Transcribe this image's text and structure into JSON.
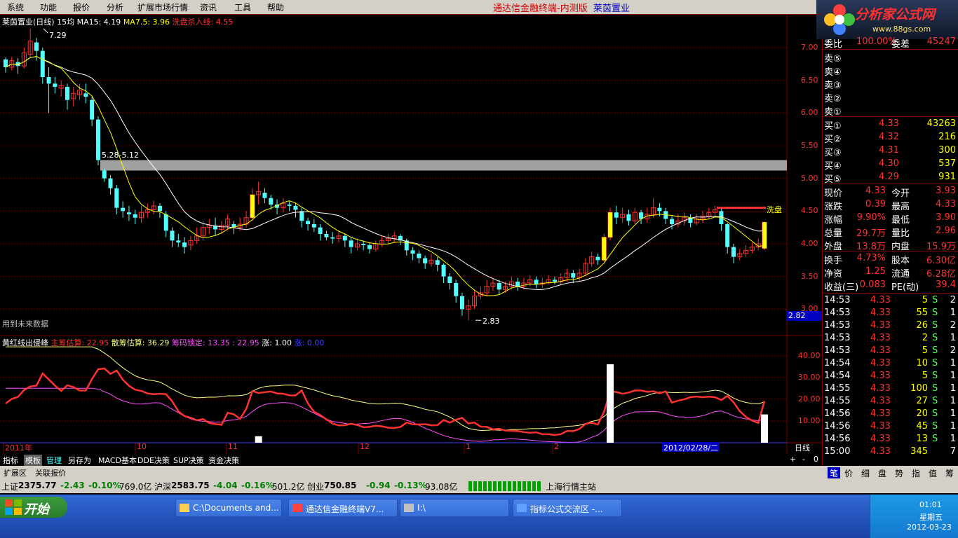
{
  "menu": [
    "系统",
    "功能",
    "报价",
    "分析",
    "扩展市场行情",
    "资讯",
    "工具",
    "帮助"
  ],
  "window_title": {
    "app": "通达信金融终端-内测版",
    "stock": "莱茵置业"
  },
  "logo": {
    "name": "分析家公式网",
    "url": "www.88gs.com"
  },
  "chart_info": {
    "stock_name": "莱茵置业(日线)",
    "ma_type": "15均",
    "ma15": "MA15: 4.19",
    "ma7": "MA7.5: 3.96",
    "wash": "洗盘杀入线: 4.55",
    "high_label": "7.29",
    "low_label": "2.83",
    "gap_label": "5.28-5.12",
    "wash_right_label": "洗盘",
    "future_label": "用到未来数据",
    "current_price_tag": "2.82"
  },
  "indicator": {
    "name": "黄红线出侵峰",
    "main": "主筹估算: 22.95",
    "loose": "散筹估算: 36.29",
    "lock": "筹码锁定: 13.35 : 22.95",
    "up": "涨: 1.00",
    "tail": "涨: 0.00"
  },
  "price_axis": [
    "7.00",
    "6.50",
    "6.00",
    "5.50",
    "5.00",
    "4.50",
    "4.00",
    "3.50",
    "3.00"
  ],
  "indicator_axis": [
    "40.00",
    "30.00",
    "20.00",
    "10.00"
  ],
  "time_axis": [
    {
      "label": "2011年",
      "x": 5
    },
    {
      "label": "10",
      "x": 193
    },
    {
      "label": "11",
      "x": 323
    },
    {
      "label": "12",
      "x": 511
    },
    {
      "label": "1",
      "x": 662
    },
    {
      "label": "2",
      "x": 788
    }
  ],
  "cursor_date": "2012/02/28/二",
  "period_label": "日线",
  "order_book": {
    "ratio_label": "委比",
    "ratio_value": "100.00%",
    "diff_label": "委差",
    "diff_value": "45247",
    "sells": [
      "卖⑤",
      "卖④",
      "卖③",
      "卖②",
      "卖①"
    ],
    "buys": [
      {
        "label": "买①",
        "price": "4.33",
        "vol": "43263"
      },
      {
        "label": "买②",
        "price": "4.32",
        "vol": "216"
      },
      {
        "label": "买③",
        "price": "4.31",
        "vol": "300"
      },
      {
        "label": "买④",
        "price": "4.30",
        "vol": "537"
      },
      {
        "label": "买⑤",
        "price": "4.29",
        "vol": "931"
      }
    ]
  },
  "quote": [
    {
      "k1": "现价",
      "v1": "4.33",
      "k2": "今开",
      "v2": "3.93"
    },
    {
      "k1": "涨跌",
      "v1": "0.39",
      "k2": "最高",
      "v2": "4.33"
    },
    {
      "k1": "涨幅",
      "v1": "9.90%",
      "k2": "最低",
      "v2": "3.90"
    },
    {
      "k1": "总量",
      "v1": "29.7万",
      "k2": "量比",
      "v2": "2.96"
    },
    {
      "k1": "外盘",
      "v1": "13.8万",
      "k2": "内盘",
      "v2": "15.9万"
    }
  ],
  "stats": [
    {
      "k1": "换手",
      "v1": "4.73%",
      "k2": "股本",
      "v2": "6.30亿"
    },
    {
      "k1": "净资",
      "v1": "1.25",
      "k2": "流通",
      "v2": "6.28亿"
    },
    {
      "k1": "收益(三)",
      "v1": "0.083",
      "k2": "PE(动)",
      "v2": "39.4"
    }
  ],
  "ticks": [
    {
      "time": "14:53",
      "price": "4.33",
      "vol": "5",
      "side": "S",
      "n": "2"
    },
    {
      "time": "14:53",
      "price": "4.33",
      "vol": "55",
      "side": "S",
      "n": "1"
    },
    {
      "time": "14:53",
      "price": "4.33",
      "vol": "26",
      "side": "S",
      "n": "2"
    },
    {
      "time": "14:53",
      "price": "4.33",
      "vol": "2",
      "side": "S",
      "n": "1"
    },
    {
      "time": "14:53",
      "price": "4.33",
      "vol": "5",
      "side": "S",
      "n": "2"
    },
    {
      "time": "14:54",
      "price": "4.33",
      "vol": "10",
      "side": "S",
      "n": "1"
    },
    {
      "time": "14:54",
      "price": "4.33",
      "vol": "5",
      "side": "S",
      "n": "1"
    },
    {
      "time": "14:55",
      "price": "4.33",
      "vol": "100",
      "side": "S",
      "n": "1"
    },
    {
      "time": "14:55",
      "price": "4.33",
      "vol": "27",
      "side": "S",
      "n": "1"
    },
    {
      "time": "14:56",
      "price": "4.33",
      "vol": "20",
      "side": "S",
      "n": "1"
    },
    {
      "time": "14:56",
      "price": "4.33",
      "vol": "45",
      "side": "S",
      "n": "1"
    },
    {
      "time": "14:56",
      "price": "4.33",
      "vol": "13",
      "side": "S",
      "n": "1"
    },
    {
      "time": "15:00",
      "price": "4.33",
      "vol": "345",
      "side": "",
      "n": "7"
    }
  ],
  "side_tabs": [
    "笔",
    "价",
    "细",
    "盘",
    "势",
    "指",
    "值",
    "筹"
  ],
  "bottom_tabs": [
    "指标",
    "模板",
    "管理",
    "另存为",
    "MACD基本",
    "DDE决策",
    "SUP决策",
    "资金决策"
  ],
  "bottom_controls": [
    "+",
    "-",
    "0"
  ],
  "ext_tabs": [
    "扩展区",
    "关联报价"
  ],
  "indexes": [
    {
      "name": "上证",
      "val": "2375.77",
      "chg": "-2.43",
      "pct": "-0.10%",
      "amt": "769.0亿"
    },
    {
      "name": "沪深",
      "val": "2583.75",
      "chg": "-4.04",
      "pct": "-0.16%",
      "amt": "501.2亿"
    },
    {
      "name": "创业",
      "val": "750.85",
      "chg": "-0.94",
      "pct": "-0.13%",
      "amt": "93.08亿"
    }
  ],
  "server": "上海行情主站",
  "taskbar": {
    "start": "开始",
    "tasks": [
      "C:\\Documents and...",
      "通达信金融终端V7...",
      "I:\\",
      "指标公式交流区 -..."
    ],
    "time": "01:01",
    "weekday": "星期五",
    "date": "2012-03-23"
  },
  "colors": {
    "up": "#ff3232",
    "down": "#54ffff",
    "yellow": "#ffff00",
    "grid": "#800000",
    "purple": "#ff50ff"
  },
  "chart_data": {
    "type": "candlestick",
    "y_range": [
      2.8,
      7.3
    ],
    "indicator_range": [
      0,
      45
    ],
    "candles": [
      [
        6.82,
        6.7,
        6.85,
        6.62
      ],
      [
        6.7,
        6.8,
        6.86,
        6.65
      ],
      [
        6.78,
        6.72,
        6.84,
        6.6
      ],
      [
        6.72,
        6.92,
        7.0,
        6.68
      ],
      [
        6.9,
        7.1,
        7.29,
        6.85
      ],
      [
        7.08,
        6.95,
        7.15,
        6.8
      ],
      [
        6.95,
        6.55,
        7.0,
        6.45
      ],
      [
        6.55,
        6.45,
        6.7,
        6.0
      ],
      [
        6.45,
        6.4,
        6.55,
        6.3
      ],
      [
        6.38,
        6.42,
        6.5,
        6.25
      ],
      [
        6.4,
        6.2,
        6.45,
        6.05
      ],
      [
        6.22,
        6.3,
        6.4,
        6.1
      ],
      [
        6.28,
        6.35,
        6.45,
        6.2
      ],
      [
        6.3,
        6.25,
        6.45,
        6.15
      ],
      [
        6.2,
        5.9,
        6.25,
        5.8
      ],
      [
        5.9,
        5.28,
        5.95,
        5.2
      ],
      [
        5.12,
        5.0,
        5.15,
        4.95
      ],
      [
        5.0,
        4.85,
        5.05,
        4.75
      ],
      [
        4.85,
        4.55,
        4.9,
        4.45
      ],
      [
        4.55,
        4.5,
        4.65,
        4.4
      ],
      [
        4.48,
        4.45,
        4.58,
        4.35
      ],
      [
        4.45,
        4.4,
        4.52,
        4.3
      ],
      [
        4.4,
        4.48,
        4.58,
        4.32
      ],
      [
        4.48,
        4.52,
        4.62,
        4.4
      ],
      [
        4.52,
        4.58,
        4.66,
        4.45
      ],
      [
        4.58,
        4.5,
        4.62,
        4.4
      ],
      [
        4.45,
        4.2,
        4.5,
        4.1
      ],
      [
        4.2,
        4.05,
        4.25,
        3.95
      ],
      [
        4.05,
        4.02,
        4.15,
        3.95
      ],
      [
        4.02,
        3.95,
        4.1,
        3.85
      ],
      [
        3.98,
        4.05,
        4.12,
        3.9
      ],
      [
        4.05,
        4.12,
        4.25,
        4.0
      ],
      [
        4.12,
        4.25,
        4.35,
        4.05
      ],
      [
        4.25,
        4.28,
        4.38,
        4.15
      ],
      [
        4.28,
        4.22,
        4.4,
        4.12
      ],
      [
        4.22,
        4.28,
        4.35,
        4.15
      ],
      [
        4.28,
        4.38,
        4.45,
        4.2
      ],
      [
        4.3,
        4.25,
        4.35,
        4.15
      ],
      [
        4.25,
        4.3,
        4.4,
        4.2
      ],
      [
        4.3,
        4.4,
        4.5,
        4.25
      ],
      [
        4.4,
        4.75,
        4.85,
        4.35
      ],
      [
        4.75,
        4.8,
        4.95,
        4.6
      ],
      [
        4.78,
        4.7,
        4.85,
        4.62
      ],
      [
        4.7,
        4.6,
        4.75,
        4.52
      ],
      [
        4.6,
        4.55,
        4.68,
        4.45
      ],
      [
        4.55,
        4.62,
        4.7,
        4.48
      ],
      [
        4.6,
        4.58,
        4.66,
        4.5
      ],
      [
        4.58,
        4.52,
        4.62,
        4.4
      ],
      [
        4.5,
        4.35,
        4.55,
        4.25
      ],
      [
        4.35,
        4.3,
        4.4,
        4.2
      ],
      [
        4.3,
        4.25,
        4.38,
        4.18
      ],
      [
        4.25,
        4.15,
        4.3,
        4.05
      ],
      [
        4.15,
        4.1,
        4.2,
        4.05
      ],
      [
        4.1,
        4.08,
        4.18,
        4.0
      ],
      [
        4.08,
        4.12,
        4.2,
        4.02
      ],
      [
        4.12,
        4.05,
        4.15,
        3.95
      ],
      [
        4.05,
        3.95,
        4.1,
        3.85
      ],
      [
        3.95,
        4.0,
        4.08,
        3.9
      ],
      [
        4.0,
        3.98,
        4.05,
        3.9
      ],
      [
        3.98,
        3.92,
        4.02,
        3.85
      ],
      [
        3.92,
        4.0,
        4.05,
        3.88
      ],
      [
        4.0,
        4.05,
        4.12,
        3.95
      ],
      [
        4.05,
        4.08,
        4.15,
        4.0
      ],
      [
        4.08,
        4.12,
        4.18,
        4.02
      ],
      [
        4.12,
        4.05,
        4.15,
        3.98
      ],
      [
        4.05,
        3.9,
        4.08,
        3.82
      ],
      [
        3.9,
        3.85,
        3.95,
        3.75
      ],
      [
        3.85,
        3.78,
        3.9,
        3.7
      ],
      [
        3.78,
        3.7,
        3.82,
        3.62
      ],
      [
        3.7,
        3.75,
        3.85,
        3.65
      ],
      [
        3.75,
        3.68,
        3.8,
        3.58
      ],
      [
        3.68,
        3.5,
        3.7,
        3.4
      ],
      [
        3.5,
        3.4,
        3.55,
        3.3
      ],
      [
        3.4,
        3.2,
        3.45,
        3.1
      ],
      [
        3.2,
        3.0,
        3.25,
        2.9
      ],
      [
        3.0,
        3.05,
        3.15,
        2.83
      ],
      [
        3.05,
        3.2,
        3.3,
        3.0
      ],
      [
        3.2,
        3.25,
        3.35,
        3.15
      ],
      [
        3.25,
        3.35,
        3.45,
        3.2
      ],
      [
        3.35,
        3.4,
        3.48,
        3.28
      ],
      [
        3.4,
        3.3,
        3.45,
        3.22
      ],
      [
        3.3,
        3.35,
        3.42,
        3.25
      ],
      [
        3.35,
        3.42,
        3.5,
        3.3
      ],
      [
        3.42,
        3.35,
        3.48,
        3.28
      ],
      [
        3.35,
        3.4,
        3.48,
        3.3
      ],
      [
        3.4,
        3.45,
        3.52,
        3.35
      ],
      [
        3.45,
        3.38,
        3.5,
        3.32
      ],
      [
        3.38,
        3.4,
        3.48,
        3.32
      ],
      [
        3.4,
        3.45,
        3.52,
        3.38
      ],
      [
        3.45,
        3.42,
        3.5,
        3.38
      ],
      [
        3.42,
        3.48,
        3.55,
        3.38
      ],
      [
        3.48,
        3.55,
        3.62,
        3.42
      ],
      [
        3.55,
        3.48,
        3.6,
        3.4
      ],
      [
        3.48,
        3.55,
        3.62,
        3.42
      ],
      [
        3.55,
        3.7,
        3.78,
        3.5
      ],
      [
        3.7,
        3.8,
        3.88,
        3.65
      ],
      [
        3.8,
        3.75,
        3.85,
        3.68
      ],
      [
        3.75,
        4.1,
        4.15,
        3.72
      ],
      [
        4.1,
        4.48,
        4.55,
        4.05
      ],
      [
        4.48,
        4.4,
        4.58,
        4.3
      ],
      [
        4.4,
        4.45,
        4.55,
        4.32
      ],
      [
        4.45,
        4.35,
        4.52,
        4.28
      ],
      [
        4.35,
        4.48,
        4.55,
        4.3
      ],
      [
        4.48,
        4.38,
        4.52,
        4.3
      ],
      [
        4.38,
        4.45,
        4.55,
        4.32
      ],
      [
        4.45,
        4.55,
        4.7,
        4.4
      ],
      [
        4.55,
        4.5,
        4.62,
        4.42
      ],
      [
        4.5,
        4.38,
        4.55,
        4.3
      ],
      [
        4.38,
        4.3,
        4.42,
        4.22
      ],
      [
        4.3,
        4.35,
        4.45,
        4.25
      ],
      [
        4.35,
        4.4,
        4.48,
        4.28
      ],
      [
        4.4,
        4.32,
        4.45,
        4.25
      ],
      [
        4.32,
        4.38,
        4.45,
        4.28
      ],
      [
        4.38,
        4.42,
        4.5,
        4.32
      ],
      [
        4.42,
        4.48,
        4.55,
        4.38
      ],
      [
        4.48,
        4.52,
        4.58,
        4.42
      ],
      [
        4.5,
        4.3,
        4.55,
        4.2
      ],
      [
        4.3,
        3.95,
        4.32,
        3.85
      ],
      [
        3.95,
        3.8,
        4.0,
        3.7
      ],
      [
        3.8,
        3.85,
        3.92,
        3.75
      ],
      [
        3.85,
        3.9,
        3.98,
        3.8
      ],
      [
        3.9,
        3.95,
        4.02,
        3.85
      ],
      [
        3.95,
        4.0,
        4.08,
        3.9
      ],
      [
        3.93,
        4.33,
        4.33,
        3.9
      ]
    ],
    "wash_level": 4.55,
    "gap_band": [
      5.12,
      5.28
    ]
  }
}
